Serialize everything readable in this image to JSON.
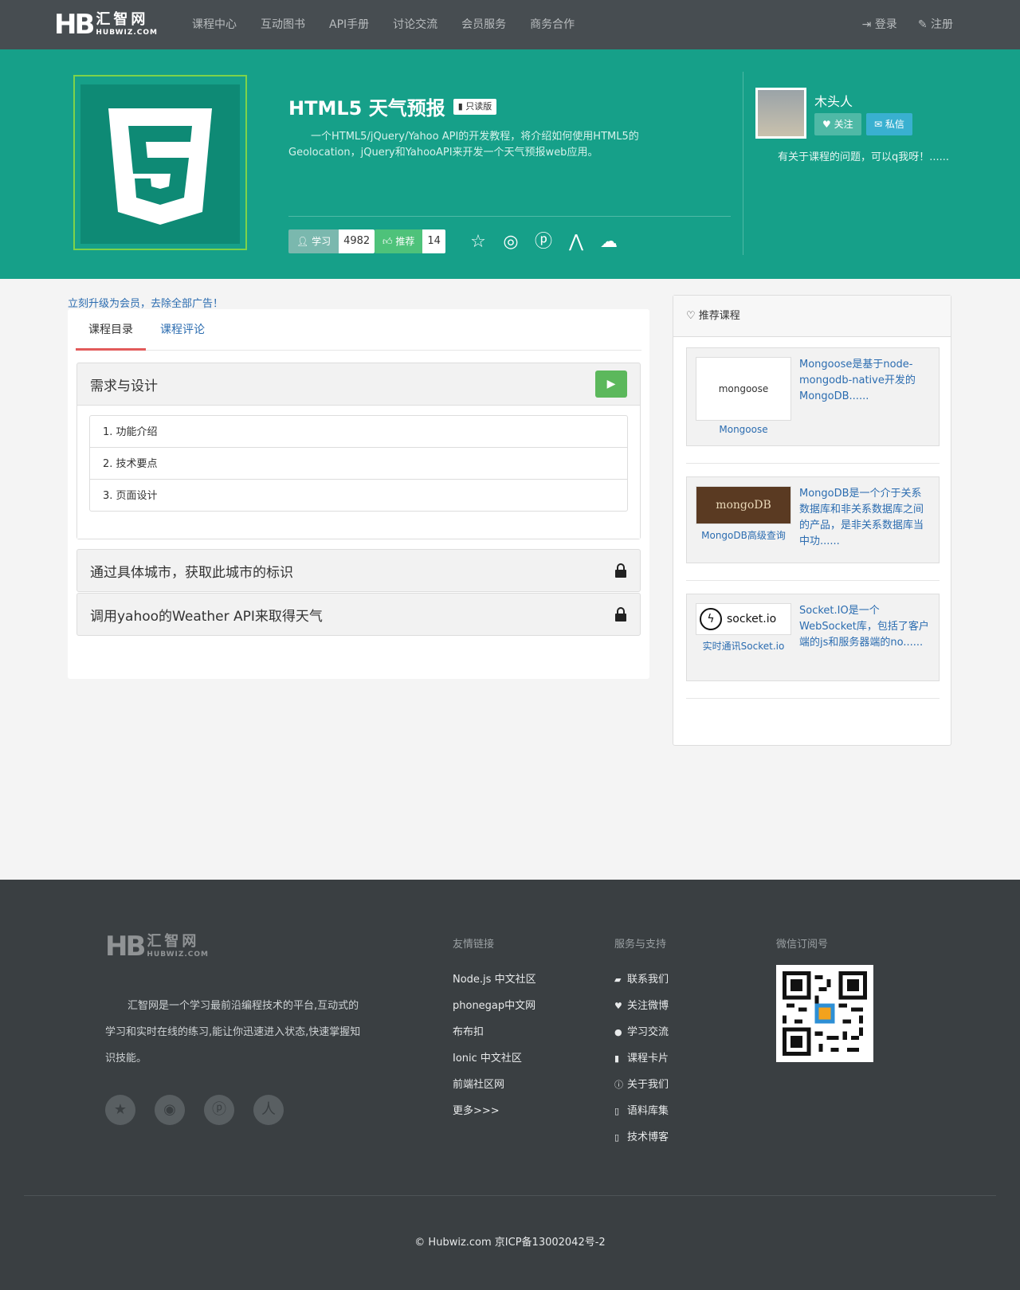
{
  "nav": {
    "logo_mark": "HB",
    "logo_cn": "汇智网",
    "logo_en": "HUBWIZ.COM",
    "links": [
      "课程中心",
      "互动图书",
      "API手册",
      "讨论交流",
      "会员服务",
      "商务合作"
    ],
    "login": "登录",
    "register": "注册"
  },
  "course": {
    "title": "HTML5 天气预报",
    "badge": "只读版",
    "description": "一个HTML5/jQuery/Yahoo API的开发教程，将介绍如何使用HTML5的Geolocation，jQuery和YahooAPI来开发一个天气预报web应用。",
    "learn_label": "学习",
    "learn_count": "4982",
    "recommend_label": "推荐",
    "recommend_count": "14",
    "share_icons": [
      "star-icon",
      "weibo-icon",
      "qq-icon",
      "renren-icon",
      "wechat-icon"
    ]
  },
  "author": {
    "name": "木头人",
    "follow": "关注",
    "message": "私信",
    "note": "有关于课程的问题，可以q我呀！......"
  },
  "main": {
    "upgrade": "立刻升级为会员，去除全部广告！",
    "tabs": [
      "课程目录",
      "课程评论"
    ],
    "chapters": [
      {
        "title": "需求与设计",
        "lessons": [
          "1. 功能介绍",
          "2. 技术要点",
          "3. 页面设计"
        ]
      },
      {
        "title": "通过具体城市，获取此城市的标识"
      },
      {
        "title": "调用yahoo的Weather API来取得天气"
      }
    ]
  },
  "sidebar": {
    "title": "推荐课程",
    "items": [
      {
        "thumb": "mongoose",
        "name": "Mongoose",
        "desc": "Mongoose是基于node-mongodb-native开发的MongoDB......"
      },
      {
        "thumb": "mongoDB",
        "name": "MongoDB高级查询",
        "desc": "MongoDB是一个介于关系数据库和非关系数据库之间的产品，是非关系数据库当中功......"
      },
      {
        "thumb": "socket.io",
        "name": "实时通讯Socket.io",
        "desc": "Socket.IO是一个WebSocket库，包括了客户端的js和服务器端的no......"
      }
    ]
  },
  "footer": {
    "about": "汇智网是一个学习最前沿编程技术的平台,互动式的学习和实时在线的练习,能让你迅速进入状态,快速掌握知识技能。",
    "links_title": "友情链接",
    "links": [
      "Node.js 中文社区",
      "phonegap中文网",
      "布布扣",
      "Ionic 中文社区",
      "前端社区网",
      "更多>>>"
    ],
    "support_title": "服务与支持",
    "support": [
      "联系我们",
      "关注微博",
      "学习交流",
      "课程卡片",
      "关于我们",
      "语料库集",
      "技术博客"
    ],
    "wechat_title": "微信订阅号",
    "copyright": "© Hubwiz.com   京ICP备13002042号-2"
  },
  "colors": {
    "nav_bg": "#474d51",
    "hero_bg": "#16a089",
    "footer_bg": "#3a3f42",
    "link": "#2b6cb0",
    "play": "#5cb85c"
  }
}
